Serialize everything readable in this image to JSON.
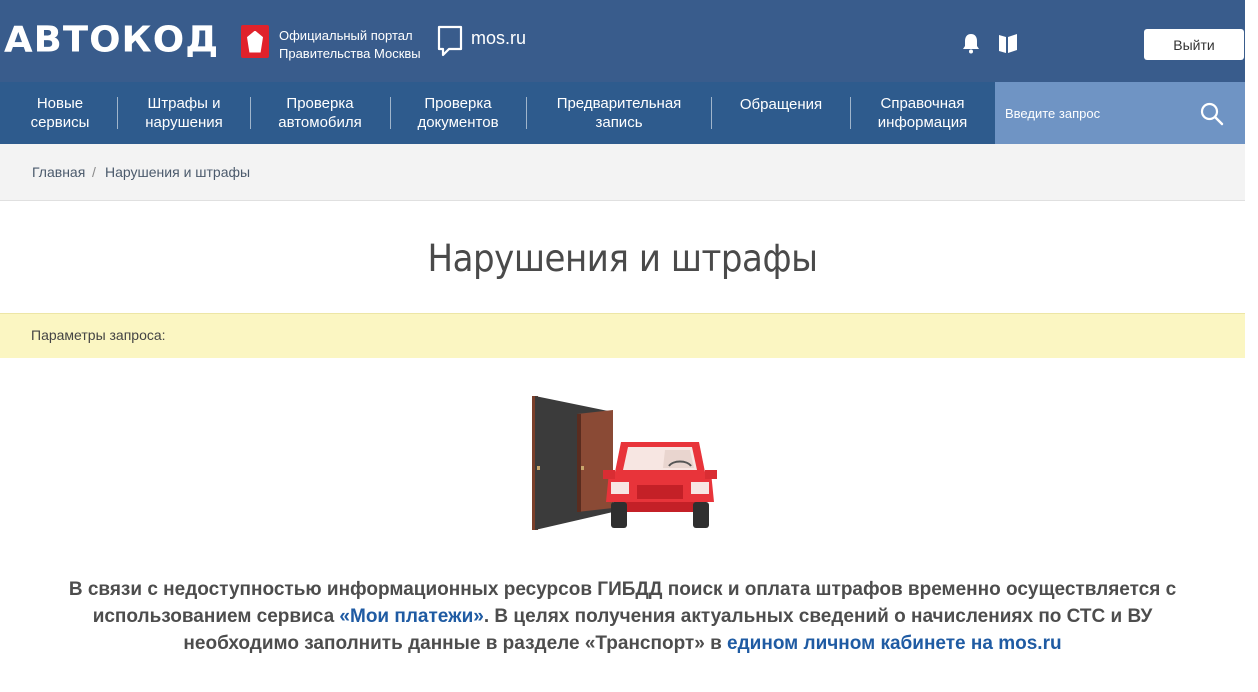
{
  "header": {
    "logo": "АВТОКОД",
    "portal_line1": "Официальный портал",
    "portal_line2": "Правительства Москвы",
    "mos_label": "mos.ru",
    "logout_label": "Выйти",
    "icons": [
      "moscow-crest-icon",
      "mos-ru-speech-icon",
      "bell-icon",
      "book-icon"
    ]
  },
  "nav": {
    "items": [
      {
        "line1": "Новые",
        "line2": "сервисы"
      },
      {
        "line1": "Штрафы и",
        "line2": "нарушения"
      },
      {
        "line1": "Проверка",
        "line2": "автомобиля"
      },
      {
        "line1": "Проверка",
        "line2": "документов"
      },
      {
        "line1": "Предварительная",
        "line2": "запись"
      },
      {
        "line1": "Обращения",
        "line2": ""
      },
      {
        "line1": "Справочная",
        "line2": "информация"
      }
    ],
    "search_placeholder": "Введите запрос"
  },
  "breadcrumb": {
    "home": "Главная",
    "separator": "/",
    "current": "Нарушения и штрафы"
  },
  "page": {
    "title": "Нарушения и штрафы",
    "params_label": "Параметры запроса:"
  },
  "notice": {
    "part1": "В связи с недоступностью информационных ресурсов ГИБДД поиск и оплата штрафов временно осуществляется с использованием сервиса ",
    "link1": "«Мои платежи»",
    "part2": ". В целях получения актуальных сведений о начислениях по СТС и ВУ необходимо заполнить данные в разделе «Транспорт» в ",
    "link2": "едином личном кабинете на mos.ru"
  },
  "colors": {
    "header_bg": "#395c8c",
    "nav_bg": "#2e5b8d",
    "search_bg": "#6f94c4",
    "params_bg": "#fbf6c2",
    "link": "#1f5ba3",
    "car_red": "#e8343a"
  }
}
